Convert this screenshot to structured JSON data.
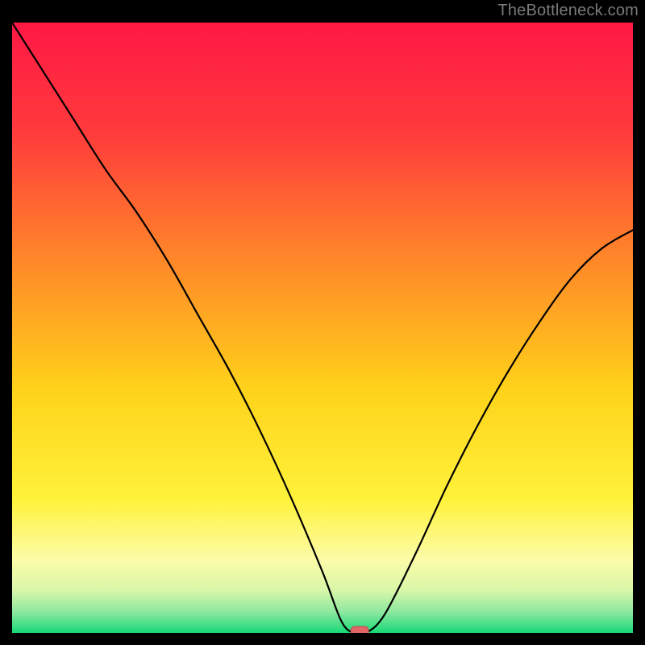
{
  "attribution": "TheBottleneck.com",
  "colors": {
    "frame": "#000000",
    "gradient_stops": [
      {
        "offset": 0.0,
        "color": "#ff1845"
      },
      {
        "offset": 0.18,
        "color": "#ff3b3c"
      },
      {
        "offset": 0.4,
        "color": "#ff8b28"
      },
      {
        "offset": 0.6,
        "color": "#ffd21a"
      },
      {
        "offset": 0.78,
        "color": "#fff23a"
      },
      {
        "offset": 0.88,
        "color": "#fcfca8"
      },
      {
        "offset": 0.93,
        "color": "#d8f7a8"
      },
      {
        "offset": 0.965,
        "color": "#8fe8a0"
      },
      {
        "offset": 1.0,
        "color": "#17d877"
      }
    ],
    "curve": "#000000",
    "marker_fill": "#e06666",
    "marker_stroke": "#c24c4c"
  },
  "chart_data": {
    "type": "line",
    "title": "",
    "xlabel": "",
    "ylabel": "",
    "xlim": [
      0,
      100
    ],
    "ylim": [
      0,
      100
    ],
    "grid": false,
    "legend": false,
    "x": [
      0,
      5,
      10,
      15,
      20,
      25,
      30,
      35,
      40,
      45,
      50,
      53,
      55,
      57,
      60,
      65,
      70,
      75,
      80,
      85,
      90,
      95,
      100
    ],
    "series": [
      {
        "name": "bottleneck-curve",
        "values": [
          100,
          92,
          84,
          76,
          69,
          61,
          52,
          43,
          33,
          22,
          10,
          2,
          0,
          0,
          3,
          13,
          24,
          34,
          43,
          51,
          58,
          63,
          66
        ]
      }
    ],
    "marker": {
      "x": 56,
      "y": 0
    }
  }
}
